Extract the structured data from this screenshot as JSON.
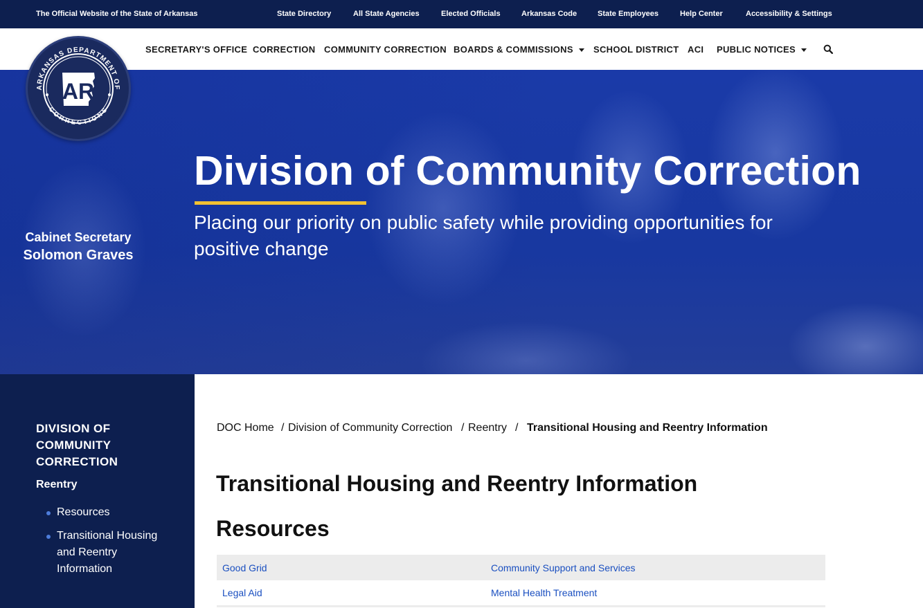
{
  "statebar": {
    "official": "The Official Website of the State of Arkansas",
    "links": [
      "State Directory",
      "All State Agencies",
      "Elected Officials",
      "Arkansas Code",
      "State Employees",
      "Help Center",
      "Accessibility & Settings"
    ]
  },
  "nav": {
    "items": [
      {
        "label": "SECRETARY'S OFFICE",
        "dropdown": false
      },
      {
        "label": "CORRECTION",
        "dropdown": false
      },
      {
        "label": "COMMUNITY CORRECTION",
        "dropdown": false
      },
      {
        "label": "BOARDS & COMMISSIONS",
        "dropdown": true
      },
      {
        "label": "SCHOOL DISTRICT",
        "dropdown": false
      },
      {
        "label": "ACI",
        "dropdown": false
      },
      {
        "label": "PUBLIC NOTICES",
        "dropdown": true
      }
    ],
    "search_icon": "search-icon"
  },
  "logo": {
    "ring_text_top": "ARKANSAS DEPARTMENT OF",
    "ring_text_bottom": "CORRECTIONS",
    "monogram": "AR"
  },
  "secretary": {
    "line1": "Cabinet Secretary",
    "line2": "Solomon Graves"
  },
  "hero": {
    "title": "Division of Community Correction",
    "subtitle": "Placing our priority on public safety while providing opportunities for positive change",
    "accent_color": "#f2c132"
  },
  "sidebar": {
    "heading": "DIVISION OF COMMUNITY CORRECTION",
    "sub": "Reentry",
    "items": [
      "Resources",
      "Transitional Housing and Reentry Information"
    ]
  },
  "breadcrumb": {
    "home": "DOC Home",
    "sep1": "/",
    "division": "Division of Community Correction",
    "sep2": "/",
    "reentry": "Reentry",
    "sep3": "/",
    "current": "Transitional Housing and Reentry Information"
  },
  "content": {
    "title": "Transitional Housing and Reentry Information",
    "section": "Resources",
    "rows": [
      [
        "Good Grid",
        "Community Support and Services"
      ],
      [
        "Legal Aid",
        "Mental Health Treatment"
      ]
    ]
  },
  "colors": {
    "navy": "#0d1f4f",
    "hero_blue": "#1a3aa8",
    "link": "#1a4fc0"
  }
}
